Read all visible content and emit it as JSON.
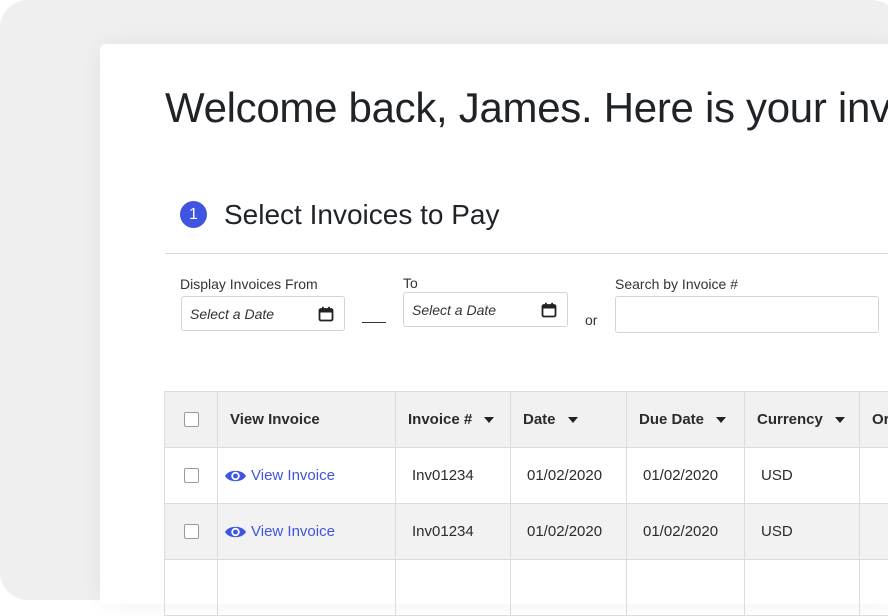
{
  "page": {
    "welcome_heading": "Welcome back, James. Here is your invo"
  },
  "step": {
    "number": "1",
    "title": "Select Invoices to Pay"
  },
  "filters": {
    "from_label": "Display Invoices From",
    "from_placeholder": "Select a Date",
    "to_label": "To",
    "to_placeholder": "Select a Date",
    "or_text": "or",
    "search_label": "Search by Invoice #",
    "search_value": ""
  },
  "table": {
    "headers": [
      "View Invoice",
      "Invoice #",
      "Date",
      "Due Date",
      "Currency",
      "Or"
    ],
    "rows": [
      {
        "view_label": "View Invoice",
        "invoice": "Inv01234",
        "date": "01/02/2020",
        "due_date": "01/02/2020",
        "currency": "USD"
      },
      {
        "view_label": "View Invoice",
        "invoice": "Inv01234",
        "date": "01/02/2020",
        "due_date": "01/02/2020",
        "currency": "USD"
      }
    ]
  },
  "colors": {
    "accent": "#3f55e0",
    "header_bg": "#f1f1f1",
    "outer_bg": "#efefef"
  },
  "icons": {
    "calendar": "calendar-icon",
    "eye": "eye-icon",
    "sort": "caret-down-icon"
  }
}
